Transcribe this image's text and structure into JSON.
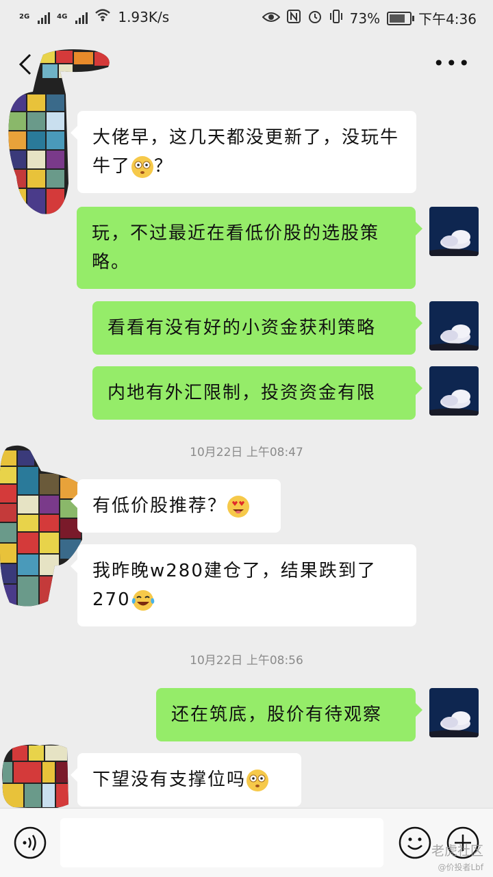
{
  "status_bar": {
    "signal_1": "2G",
    "signal_2": "4G",
    "speed": "1.93K/s",
    "battery": "73%",
    "time": "下午4:36"
  },
  "header": {
    "back_icon": "chevron-left-icon",
    "more_icon": "more-dots-icon"
  },
  "messages": [
    {
      "from": "them",
      "text": "大佬早，这几天都没更新了，没玩牛牛了",
      "tail": "？",
      "emoji": "dazed-face-emoji"
    },
    {
      "from": "me",
      "text": "玩，不过最近在看低价股的选股策略。"
    },
    {
      "from": "me",
      "text": "看看有没有好的小资金获利策略"
    },
    {
      "from": "me",
      "text": "内地有外汇限制，投资资金有限"
    },
    {
      "from": "them",
      "text": "有低价股推荐？",
      "emoji": "heart-eyes-emoji"
    },
    {
      "from": "them",
      "text": "我昨晚w280建仓了，结果跌到了270",
      "emoji": "tears-of-joy-emoji"
    },
    {
      "from": "me",
      "text": "还在筑底，股价有待观察"
    },
    {
      "from": "them",
      "text": "下望没有支撑位吗",
      "emoji": "dazed-face-emoji"
    }
  ],
  "timestamps": [
    "10月22日  上午08:47",
    "10月22日  上午08:56"
  ],
  "input_bar": {
    "placeholder": "",
    "voice_icon": "voice-icon",
    "emoji_icon": "emoji-face-icon",
    "plus_icon": "plus-circle-icon"
  },
  "watermark": {
    "main": "老虎社区",
    "sub": "@价投者Lbf"
  },
  "colors": {
    "background": "#ededed",
    "incoming_bubble": "#ffffff",
    "outgoing_bubble": "#95ec69"
  }
}
